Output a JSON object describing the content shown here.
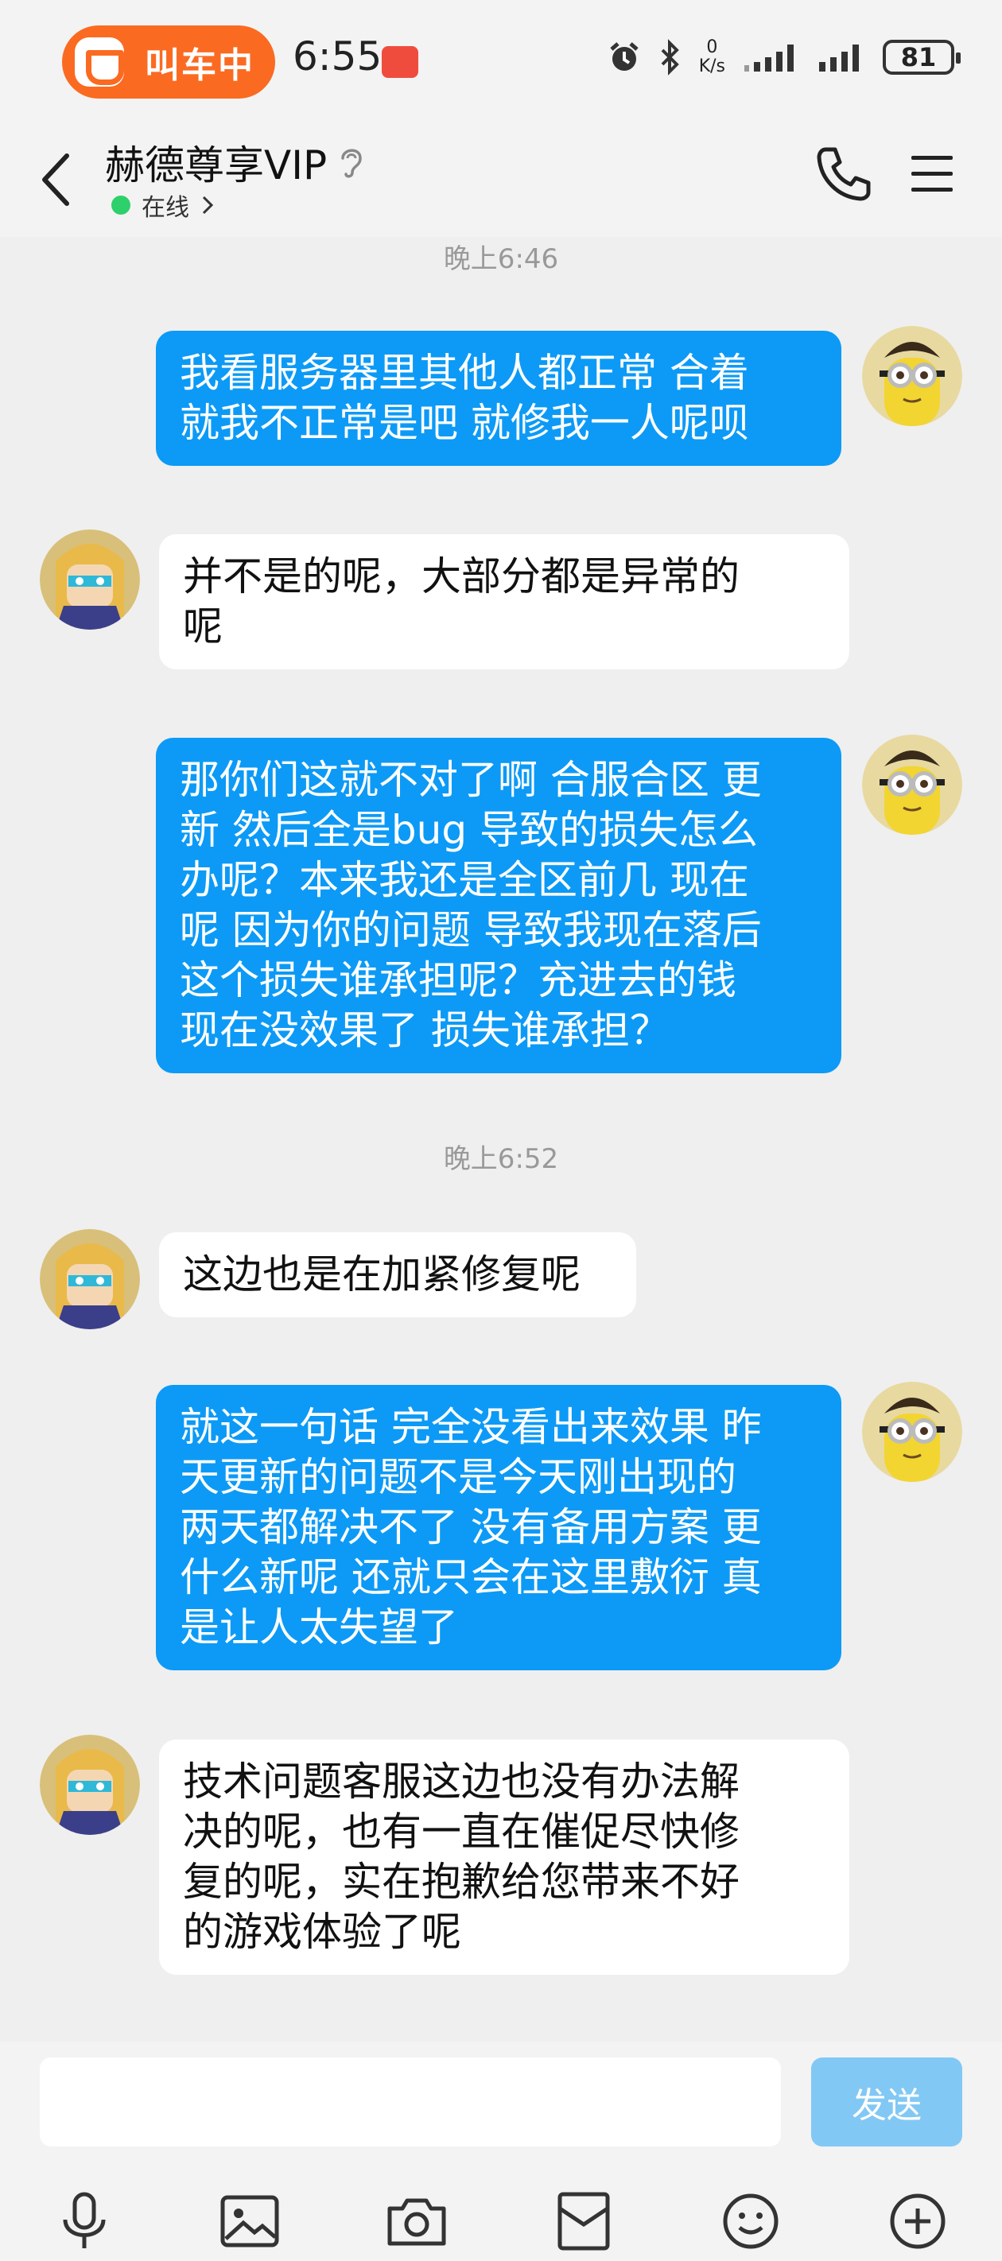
{
  "status_bar": {
    "ride_label": "叫车中",
    "time": "6:55",
    "net_speed_value": "0",
    "net_speed_unit": "K/s",
    "battery": "81"
  },
  "header": {
    "title": "赫德尊享VIP",
    "presence": "在线"
  },
  "messages": [
    {
      "type": "time",
      "text": "晚上6:46"
    },
    {
      "type": "me",
      "lines": [
        "我看服务器里其他人都正常 合着",
        "就我不正常是吧 就修我一人呢呗"
      ]
    },
    {
      "type": "them",
      "lines": [
        "并不是的呢，大部分都是异常的",
        "呢"
      ]
    },
    {
      "type": "me",
      "lines": [
        "那你们这就不对了啊 合服合区 更",
        "新 然后全是bug 导致的损失怎么",
        "办呢？本来我还是全区前几 现在",
        "呢 因为你的问题 导致我现在落后",
        "这个损失谁承担呢？充进去的钱",
        "现在没效果了 损失谁承担？"
      ]
    },
    {
      "type": "time",
      "text": "晚上6:52"
    },
    {
      "type": "them",
      "lines": [
        "这边也是在加紧修复呢"
      ]
    },
    {
      "type": "me",
      "lines": [
        "就这一句话 完全没看出来效果 昨",
        "天更新的问题不是今天刚出现的",
        "两天都解决不了 没有备用方案 更",
        "什么新呢 还就只会在这里敷衍 真",
        "是让人太失望了"
      ]
    },
    {
      "type": "them",
      "lines": [
        "技术问题客服这边也没有办法解",
        "决的呢，也有一直在催促尽快修",
        "复的呢，实在抱歉给您带来不好",
        "的游戏体验了呢"
      ]
    }
  ],
  "composer": {
    "placeholder": "",
    "send_label": "发送"
  },
  "colors": {
    "my_bubble": "#0c9af6",
    "their_bubble": "#ffffff",
    "send_disabled": "#82c8f5",
    "online": "#2ed06b",
    "ride_pill": "#fb6a21"
  },
  "icons": {
    "toolbar": [
      "microphone-icon",
      "image-icon",
      "camera-icon",
      "red-packet-icon",
      "emoji-icon",
      "plus-icon"
    ]
  }
}
